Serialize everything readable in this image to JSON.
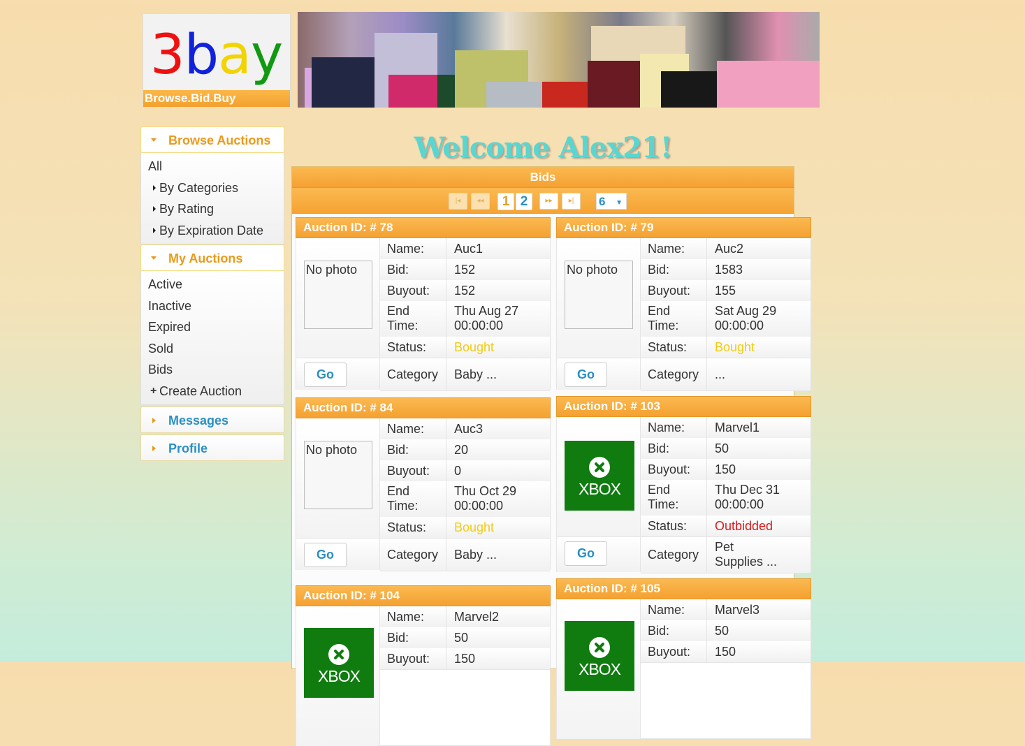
{
  "logo": {
    "letters": [
      {
        "ch": "3",
        "color": "#ee1111"
      },
      {
        "ch": "b",
        "color": "#1122dd"
      },
      {
        "ch": "a",
        "color": "#f2d400"
      },
      {
        "ch": "y",
        "color": "#119911"
      }
    ],
    "tagline": "Browse.Bid.Buy"
  },
  "sidebar": {
    "browse": {
      "title": "Browse Auctions",
      "items": [
        "All",
        "By Categories",
        "By Rating",
        "By Expiration Date"
      ]
    },
    "my": {
      "title": "My Auctions",
      "items": [
        "Active",
        "Inactive",
        "Expired",
        "Sold",
        "Bids",
        "Create Auction"
      ]
    },
    "messages": "Messages",
    "profile": "Profile"
  },
  "welcome": "Welcome Alex21!",
  "panel": {
    "title": "Bids",
    "pager": {
      "pages": [
        "1",
        "2"
      ],
      "current_page": "1",
      "per_page": "6"
    }
  },
  "labels": {
    "name": "Name:",
    "bid": "Bid:",
    "buyout": "Buyout:",
    "end_time_1": "End",
    "end_time_2": "Time:",
    "status": "Status:",
    "category": "Category",
    "go": "Go",
    "no_photo": "No photo",
    "xbox": "XBOX"
  },
  "status_colors": {
    "Bought": "#f2cb11",
    "Outbidded": "#e01818"
  },
  "auctions": [
    {
      "id": "Auction ID: # 78",
      "name": "Auc1",
      "bid": "152",
      "buyout": "152",
      "end1": "Thu Aug 27",
      "end2": "00:00:00",
      "status": "Bought",
      "category1": "Baby ...",
      "category2": "",
      "photo": "none"
    },
    {
      "id": "Auction ID: # 79",
      "name": "Auc2",
      "bid": "1583",
      "buyout": "155",
      "end1": "Sat Aug 29",
      "end2": "00:00:00",
      "status": "Bought",
      "category1": "...",
      "category2": "",
      "photo": "none"
    },
    {
      "id": "Auction ID: # 84",
      "name": "Auc3",
      "bid": "20",
      "buyout": "0",
      "end1": "Thu Oct 29",
      "end2": "00:00:00",
      "status": "Bought",
      "category1": "Baby ...",
      "category2": "",
      "photo": "none"
    },
    {
      "id": "Auction ID: # 103",
      "name": "Marvel1",
      "bid": "50",
      "buyout": "150",
      "end1": "Thu Dec 31",
      "end2": "00:00:00",
      "status": "Outbidded",
      "category1": "Pet",
      "category2": "Supplies ...",
      "photo": "xbox"
    },
    {
      "id": "Auction ID: # 104",
      "name": "Marvel2",
      "bid": "50",
      "buyout": "150",
      "end1": "",
      "end2": "",
      "status": "",
      "category1": "",
      "category2": "",
      "photo": "xbox"
    },
    {
      "id": "Auction ID: # 105",
      "name": "Marvel3",
      "bid": "50",
      "buyout": "150",
      "end1": "",
      "end2": "",
      "status": "",
      "category1": "",
      "category2": "",
      "photo": "xbox"
    }
  ]
}
